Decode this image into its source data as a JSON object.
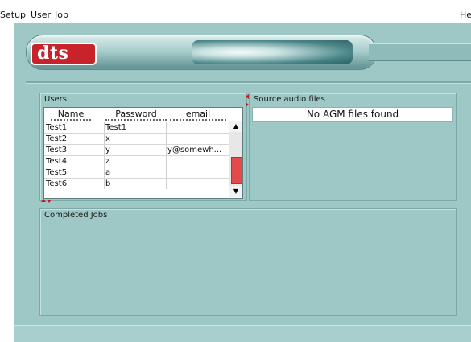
{
  "menu": {
    "setup": "Setup",
    "user": "User",
    "job": "Job",
    "help": "He"
  },
  "brand": {
    "logo_text": "dts",
    "logo_color": "#c8222b"
  },
  "users_panel": {
    "title": "Users",
    "columns": [
      "Name",
      "Password",
      "email"
    ],
    "rows": [
      [
        "Test1",
        "Test1",
        ""
      ],
      [
        "Test2",
        "x",
        ""
      ],
      [
        "Test3",
        "y",
        "y@somewh..."
      ],
      [
        "Test4",
        "z",
        ""
      ],
      [
        "Test5",
        "a",
        ""
      ],
      [
        "Test6",
        "b",
        ""
      ]
    ]
  },
  "source_panel": {
    "title": "Source audio files",
    "empty_message": "No AGM files found"
  },
  "completed_panel": {
    "title": "Completed Jobs"
  },
  "colors": {
    "window_bg": "#9dc8c6",
    "scroll_thumb": "#e34a4a",
    "accent_red": "#c01b1b"
  }
}
